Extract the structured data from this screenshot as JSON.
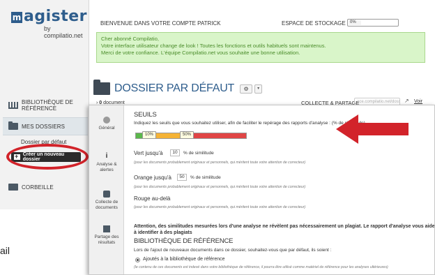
{
  "brand": {
    "logo_text": "agister",
    "logo_letter": "m",
    "logo_sub": "by compilatio.net"
  },
  "sidebar": {
    "items": [
      {
        "label": "Bibliothèque de référence",
        "icon": "library-icon"
      },
      {
        "label": "Mes dossiers",
        "icon": "folder-icon"
      },
      {
        "label": "Corbeille",
        "icon": "trash-icon"
      }
    ],
    "sub_item": "Dossier par défaut",
    "create_button": "Créer un nouveau dossier"
  },
  "header": {
    "welcome": "Bienvenue dans votre compte PATRICK",
    "storage_label": "Espace de stockage",
    "storage_value": "0%",
    "storage_percent": 0
  },
  "notice": {
    "lines": [
      "Cher abonné Compilatio,",
      "Votre interface utilisateur change de look ! Toutes les fonctions et outils habituels sont maintenus.",
      "Merci de votre confiance. L'équipe Compilatio.net vous souhaite une bonne utilisation."
    ]
  },
  "folder": {
    "title": "Dossier par défaut",
    "gear_icon": "⚙",
    "caret": "▾",
    "doc_count": "0",
    "doc_label": "document",
    "collect_label": "Collecte & Partage",
    "collect_placeholder": "ace.compilatio.net/doss",
    "link_text": "Voir"
  },
  "panel": {
    "nav": [
      {
        "label": "Général",
        "icon": "general-icon"
      },
      {
        "label": "Analyse & alertes",
        "icon": "analysis-icon"
      },
      {
        "label": "Collecte de documents",
        "icon": "collect-icon"
      },
      {
        "label": "Partage des résultats",
        "icon": "share-icon"
      }
    ],
    "seuils_title": "Seuils",
    "seuils_intro": "Indiquez les seuils que vous souhaitez utiliser, afin de faciliter le repérage des rapports d'analyse : (% de similitude)",
    "bar_markers": [
      "10%",
      "50%"
    ],
    "rows": [
      {
        "label": "Vert jusqu'à",
        "value": "10",
        "suffix": "% de similitude",
        "hint": "(pour les documents probablement originaux et personnels, qui méritent toute votre attention de correcteur)"
      },
      {
        "label": "Orange jusqu'à",
        "value": "50",
        "suffix": "% de similitude",
        "hint": "(pour les documents probablement originaux et personnels, qui méritent toute votre attention de correcteur)"
      },
      {
        "label": "Rouge au-delà",
        "value": "",
        "suffix": "",
        "hint": "(pour les documents probablement originaux et personnels, qui méritent toute votre attention de correcteur)"
      }
    ],
    "warning": "Attention, des similitudes mesurées lors d'une analyse ne révèlent pas nécessairement un plagiat. Le rapport d'analyse vous aide à identifier à des plagiats",
    "library_title": "Bibliothèque de référence",
    "library_intro": "Lors de l'ajout de nouveaux documents dans ce dossier, souhaitez-vous que par défaut, ils soient :",
    "radio_label": "Ajoutés à la bibliothèque de référence",
    "radio_hint": "(le contenu de ces documents est indexé dans votre bibliothèque de référence, il pourra être utilisé comme matériel de référence pour les analyses ultérieures)"
  },
  "stray_text": "ail",
  "colors": {
    "brand_blue": "#2e5d8c",
    "annotation_red": "#d2232a",
    "notice_green": "#d9f5c9",
    "threshold_green": "#5bb84b",
    "threshold_orange": "#f5b335",
    "threshold_red": "#e04545"
  }
}
